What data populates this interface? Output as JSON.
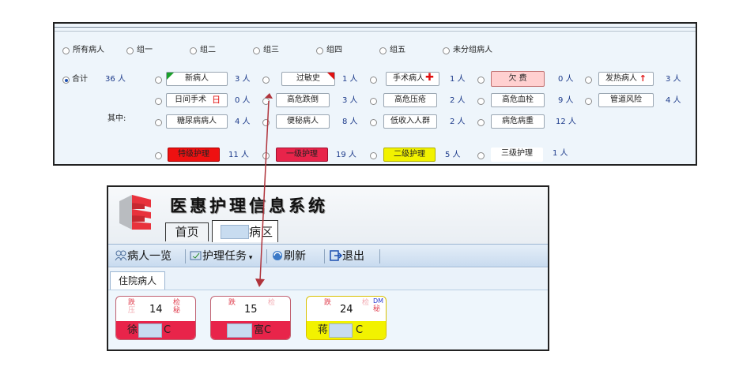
{
  "filter": {
    "groups": [
      "所有病人",
      "组一",
      "组二",
      "组三",
      "组四",
      "组五",
      "未分组病人"
    ],
    "total_label": "合计",
    "total_count": "36 人",
    "sub_label": "其中:",
    "items": [
      {
        "label": "新病人",
        "count": "3 人"
      },
      {
        "label": "过敏史",
        "count": "1 人"
      },
      {
        "label": "手术病人",
        "count": "1 人"
      },
      {
        "label": "欠 费",
        "count": "0 人"
      },
      {
        "label": "发热病人",
        "count": "3 人"
      },
      {
        "label": "日间手术",
        "count": "0 人",
        "suffix": "日"
      },
      {
        "label": "高危跌倒",
        "count": "3 人"
      },
      {
        "label": "高危压疮",
        "count": "2 人"
      },
      {
        "label": "高危血栓",
        "count": "9 人"
      },
      {
        "label": "管道风险",
        "count": "4 人"
      },
      {
        "label": "糖尿病病人",
        "count": "4 人"
      },
      {
        "label": "便秘病人",
        "count": "8 人"
      },
      {
        "label": "低收入人群",
        "count": "2 人"
      },
      {
        "label": "病危病重",
        "count": "12 人"
      }
    ],
    "care_levels": [
      {
        "label": "特级护理",
        "count": "11 人",
        "color": "#ee1111"
      },
      {
        "label": "一级护理",
        "count": "19 人",
        "color": "#e8244a"
      },
      {
        "label": "二级护理",
        "count": "5 人",
        "color": "#f2f200"
      },
      {
        "label": "三级护理",
        "count": "1 人",
        "color": "#ffffff"
      }
    ]
  },
  "app": {
    "title": "医惠护理信息系统",
    "tabs": [
      "首页",
      "病区"
    ],
    "toolbar": [
      "病人一览",
      "护理任务",
      "刷新",
      "退出"
    ],
    "subtab": "住院病人",
    "cards": [
      {
        "bed": "14",
        "name_start": "徐",
        "name_end": "C",
        "marks": [
          "跌",
          "检",
          "秘",
          "压"
        ],
        "color": "#e8244a"
      },
      {
        "bed": "15",
        "name_start": "",
        "name_end": "富C",
        "marks": [
          "跌",
          "检"
        ],
        "color": "#e8244a"
      },
      {
        "bed": "24",
        "name_start": "蒋",
        "name_end": "C",
        "marks": [
          "跌",
          "检",
          "DM",
          "秘"
        ],
        "color": "#f2f200"
      }
    ]
  }
}
